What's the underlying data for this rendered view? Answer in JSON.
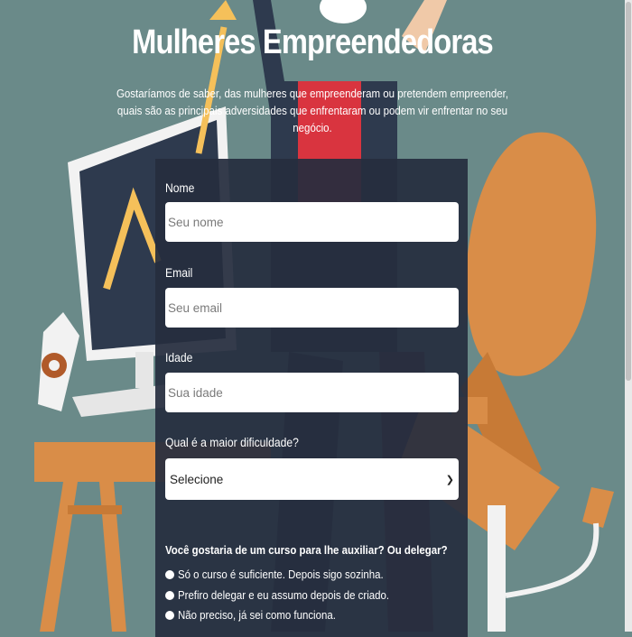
{
  "page": {
    "title": "Mulheres Empreendedoras",
    "subtitle": "Gostaríamos de saber, das mulheres que empreenderam ou pretendem empreender, quais são as principais adversidades que enfrentaram ou podem vir enfrentar no seu negócio."
  },
  "form": {
    "name_label": "Nome",
    "name_placeholder": "Seu nome",
    "email_label": "Email",
    "email_placeholder": "Seu email",
    "age_label": "Idade",
    "age_placeholder": "Sua idade",
    "difficulty_label": "Qual é a maior dificuldade?",
    "difficulty_selected": "Selecione",
    "course_question": "Você gostaria de um curso para lhe auxiliar? Ou delegar?",
    "options": [
      "Só o curso é suficiente. Depois sigo sozinha.",
      "Prefiro delegar e eu assumo depois de criado.",
      "Não preciso, já sei como funciona."
    ]
  },
  "colors": {
    "background": "#6a8a89",
    "form_panel": "#262d3e",
    "accent_orange": "#d98d48",
    "accent_yellow": "#f5c05a"
  }
}
